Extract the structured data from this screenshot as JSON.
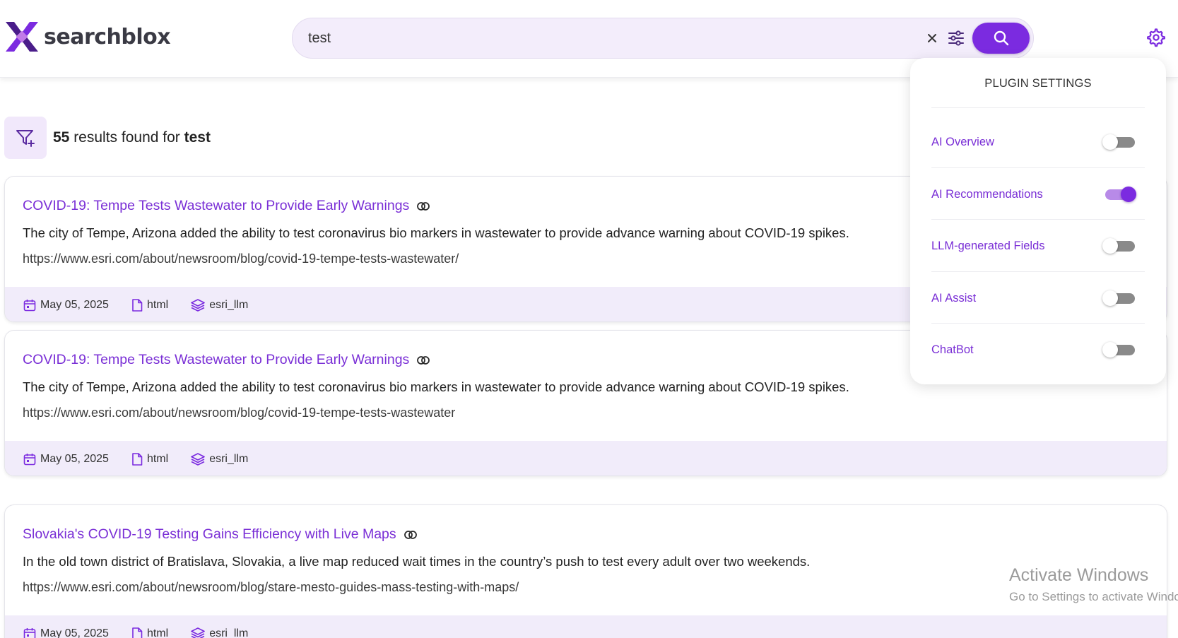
{
  "brand": {
    "name": "searchblox",
    "primary_color": "#7b2be0",
    "accent_color": "#7a2fd6"
  },
  "search": {
    "value": "test",
    "placeholder": "",
    "clear_icon": "close-icon",
    "filter_icon": "sliders-icon",
    "submit_icon": "search-icon"
  },
  "header": {
    "settings_icon": "gear-icon"
  },
  "results": {
    "count": "55",
    "text_middle": " results found for ",
    "query": "test",
    "filter_icon": "filter-plus-icon",
    "items": [
      {
        "title": "COVID-19: Tempe Tests Wastewater to Provide Early Warnings",
        "description": "The city of Tempe, Arizona added the ability to test coronavirus bio markers in wastewater to provide advance warning about COVID-19 spikes.",
        "url": "https://www.esri.com/about/newsroom/blog/covid-19-tempe-tests-wastewater/",
        "date": "May 05, 2025",
        "type": "html",
        "collection": "esri_llm"
      },
      {
        "title": "COVID-19: Tempe Tests Wastewater to Provide Early Warnings",
        "description": "The city of Tempe, Arizona added the ability to test coronavirus bio markers in wastewater to provide advance warning about COVID-19 spikes.",
        "url": "https://www.esri.com/about/newsroom/blog/covid-19-tempe-tests-wastewater",
        "date": "May 05, 2025",
        "type": "html",
        "collection": "esri_llm"
      },
      {
        "title": "Slovakia's COVID-19 Testing Gains Efficiency with Live Maps",
        "description": "In the old town district of Bratislava, Slovakia, a live map reduced wait times in the country’s push to test every adult over two weekends.",
        "url": "https://www.esri.com/about/newsroom/blog/stare-mesto-guides-mass-testing-with-maps/",
        "date": "May 05, 2025",
        "type": "html",
        "collection": "esri_llm"
      }
    ]
  },
  "plugin_settings": {
    "title": "PLUGIN SETTINGS",
    "items": [
      {
        "label": "AI Overview",
        "enabled": false
      },
      {
        "label": "AI Recommendations",
        "enabled": true
      },
      {
        "label": "LLM-generated Fields",
        "enabled": false
      },
      {
        "label": "AI Assist",
        "enabled": false
      },
      {
        "label": "ChatBot",
        "enabled": false
      }
    ]
  },
  "watermark": {
    "line1": "Activate Windows",
    "line2": "Go to Settings to activate Windows."
  }
}
